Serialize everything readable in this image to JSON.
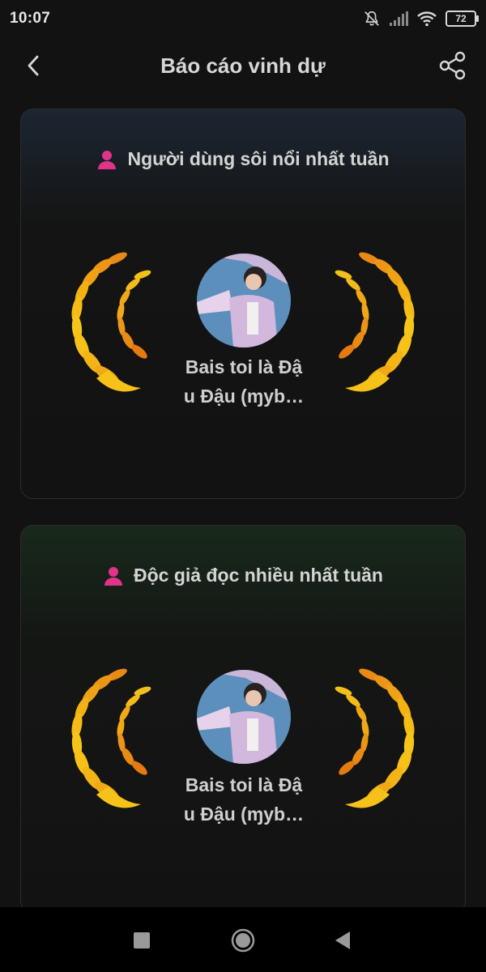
{
  "status_bar": {
    "time": "10:07",
    "battery": "72",
    "icons": [
      "mute-bell-icon",
      "signal-icon",
      "wifi-icon",
      "battery-icon"
    ]
  },
  "header": {
    "title": "Báo cáo vinh dự",
    "back_icon": "chevron-left-icon",
    "share_icon": "share-icon"
  },
  "cards": [
    {
      "title": "Người dùng sôi nổi nhất tuần",
      "icon": "user-icon",
      "user_name_line1": "Bais toi là Đậ",
      "user_name_line2": "u Đậu (ɱyb…",
      "accent": "#1c2631"
    },
    {
      "title": "Độc giả đọc nhiều nhất tuần",
      "icon": "user-icon",
      "user_name_line1": "Bais toi là Đậ",
      "user_name_line2": "u Đậu (ɱyb…",
      "accent": "#18291b"
    }
  ],
  "colors": {
    "user_icon": "#e0338a",
    "laurel_light": "#f6c21a",
    "laurel_dark": "#e47a10"
  },
  "nav_bar": {
    "icons": [
      "recent-apps-icon",
      "home-icon",
      "back-icon"
    ]
  }
}
